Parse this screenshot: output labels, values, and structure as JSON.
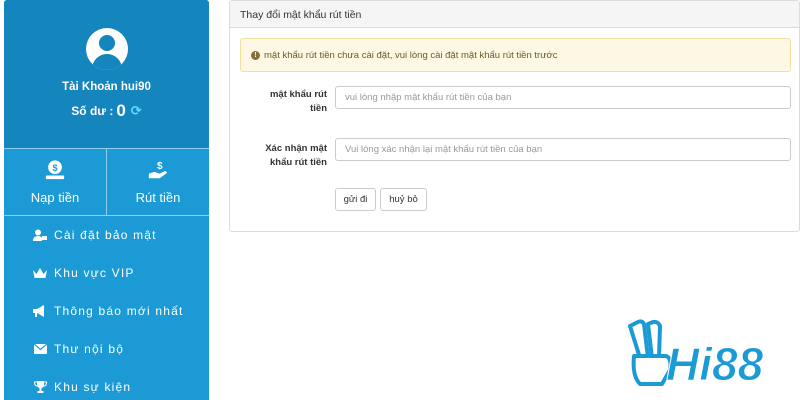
{
  "sidebar": {
    "account_name": "Tài Khoản hui90",
    "balance_label": "Số dư :",
    "balance_value": "0",
    "quick_actions": [
      {
        "label": "Nạp tiền",
        "icon": "deposit-icon"
      },
      {
        "label": "Rút tiền",
        "icon": "withdraw-icon"
      }
    ],
    "menu": [
      {
        "label": "Cài đặt bảo mật",
        "icon": "user-lock-icon"
      },
      {
        "label": "Khu vực VIP",
        "icon": "crown-icon"
      },
      {
        "label": "Thông báo mới nhất",
        "icon": "megaphone-icon"
      },
      {
        "label": "Thư nội bộ",
        "icon": "envelope-icon"
      },
      {
        "label": "Khu sự kiện",
        "icon": "trophy-icon"
      }
    ]
  },
  "panel": {
    "title": "Thay đổi mật khẩu rút tiền",
    "alert": "mật khẩu rút tiền chưa cài đặt, vui lòng cài đặt mật khẩu rút tiền trước",
    "fields": [
      {
        "label_line1": "mật khẩu rút",
        "label_line2": "tiền",
        "placeholder": "vui lòng nhập mật khẩu rút tiền của bạn"
      },
      {
        "label_line1": "Xác nhận mật",
        "label_line2": "khẩu rút tiền",
        "placeholder": "Vui lòng xác nhận lại mật khẩu rút tiền của bạn"
      }
    ],
    "submit_label": "gửi đi",
    "cancel_label": "huỷ bỏ"
  },
  "logo": {
    "text": "Hi88",
    "color": "#1b9ad6"
  },
  "colors": {
    "sidebar": "#1b9ad6",
    "profile": "#1585bd",
    "alert_bg": "#fcf8e3"
  }
}
